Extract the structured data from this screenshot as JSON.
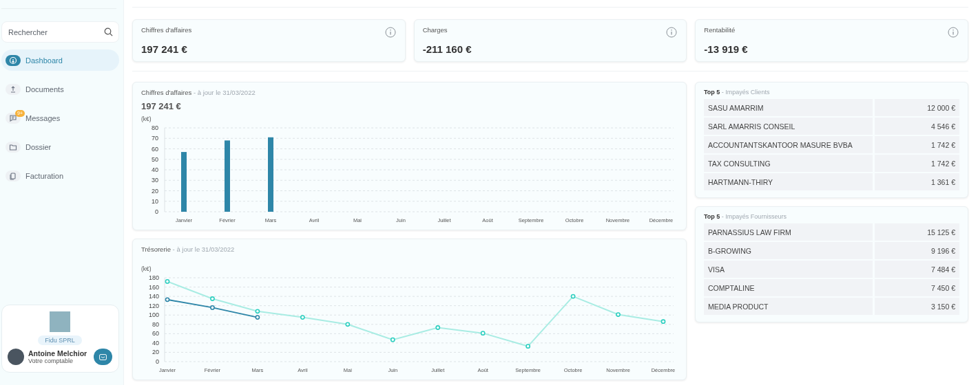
{
  "sidebar": {
    "search": {
      "placeholder": "Rechercher"
    },
    "nav": [
      {
        "label": "Dashboard",
        "selected": true
      },
      {
        "label": "Documents",
        "selected": false
      },
      {
        "label": "Messages",
        "selected": false,
        "badge": "9+"
      },
      {
        "label": "Dossier",
        "selected": false
      },
      {
        "label": "Facturation",
        "selected": false
      }
    ],
    "profile": {
      "company": "Fidu SPRL",
      "name": "Antoine Melchior",
      "role": "Votre comptable"
    }
  },
  "kpis": [
    {
      "label": "Chiffres d'affaires",
      "value": "197 241 €"
    },
    {
      "label": "Charges",
      "value": "-211 160 €"
    },
    {
      "label": "Rentabilité",
      "value": "-13 919 €"
    }
  ],
  "revenue_chart": {
    "title": "Chiffres d'affaires",
    "subtitle": "- à jour le 31/03/2022",
    "total": "197 241 €",
    "chart_data": {
      "type": "bar",
      "ylabel": "(k€)",
      "categories": [
        "Janvier",
        "Février",
        "Mars",
        "Avril",
        "Mai",
        "Juin",
        "Juillet",
        "Août",
        "Septembre",
        "Octobre",
        "Novembre",
        "Décembre"
      ],
      "series": [
        {
          "color": "#2e86a8",
          "values": [
            57,
            68,
            71,
            null,
            null,
            null,
            null,
            null,
            null,
            null,
            null,
            null
          ]
        }
      ],
      "grid": true,
      "ylim": [
        0,
        80
      ],
      "yticks": [
        0,
        10,
        20,
        30,
        40,
        50,
        60,
        70,
        80
      ]
    }
  },
  "treasury_chart": {
    "title": "Trésorerie",
    "subtitle": "- à jour le 31/03/2022",
    "chart_data": {
      "type": "line",
      "ylabel": "(k€)",
      "categories": [
        "Janvier",
        "Février",
        "Mars",
        "Avril",
        "Mai",
        "Juin",
        "Juillet",
        "Août",
        "Septembre",
        "Octobre",
        "Novembre",
        "Décembre"
      ],
      "series": [
        {
          "color": "#a8ece3",
          "marker": true,
          "values": [
            172,
            135,
            108,
            95,
            80,
            47,
            73,
            61,
            33,
            140,
            101,
            86
          ]
        },
        {
          "color": "#2e86a8",
          "marker": true,
          "values": [
            133,
            116,
            95,
            null,
            null,
            null,
            null,
            null,
            null,
            null,
            null,
            null
          ]
        }
      ],
      "grid": true,
      "ylim": [
        0,
        180
      ],
      "yticks": [
        0,
        20,
        40,
        60,
        80,
        100,
        120,
        140,
        160,
        180
      ]
    }
  },
  "unpaid_clients": {
    "title": "Top 5",
    "subtitle": "- Impayés Clients",
    "rows": [
      {
        "name": "SASU AMARRIM",
        "amount": "12 000 €"
      },
      {
        "name": "SARL AMARRIS CONSEIL",
        "amount": "4 546 €"
      },
      {
        "name": "ACCOUNTANTSKANTOOR MASURE BVBA",
        "amount": "1 742 €"
      },
      {
        "name": "TAX CONSULTING",
        "amount": "1 742 €"
      },
      {
        "name": "HARTMANN-THIRY",
        "amount": "1 361 €"
      }
    ]
  },
  "unpaid_suppliers": {
    "title": "Top 5",
    "subtitle": "- Impayés Fournisseurs",
    "rows": [
      {
        "name": "PARNASSIUS LAW FIRM",
        "amount": "15 125 €"
      },
      {
        "name": "B-GROWING",
        "amount": "9 196 €"
      },
      {
        "name": "VISA",
        "amount": "7 484 €"
      },
      {
        "name": "COMPTALINE",
        "amount": "7 450 €"
      },
      {
        "name": "MEDIA PRODUCT",
        "amount": "3 150 €"
      }
    ]
  }
}
